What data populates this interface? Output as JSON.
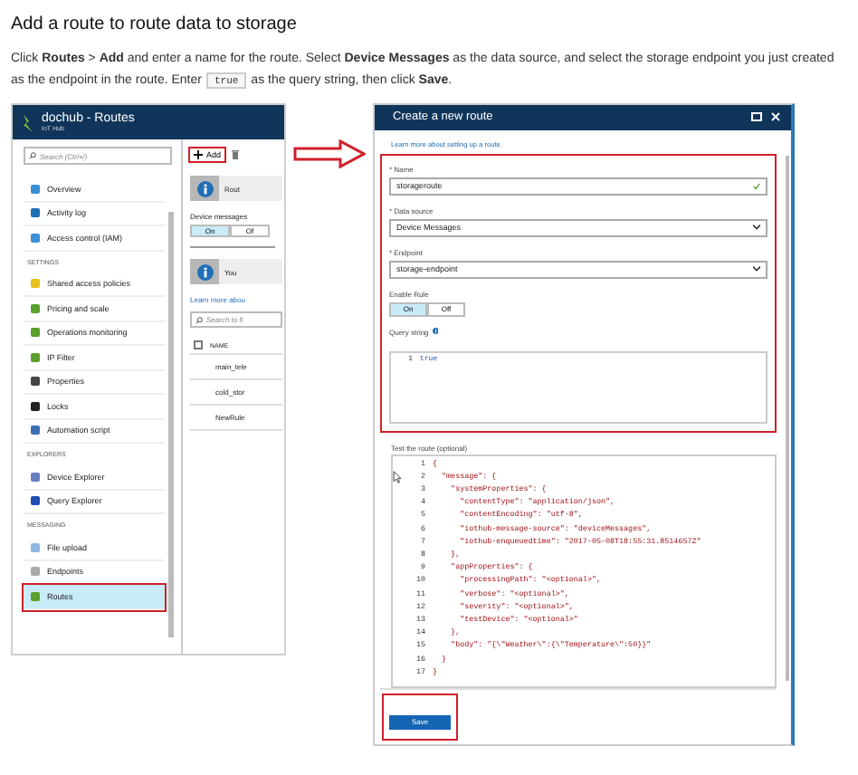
{
  "article": {
    "heading": "Add a route to route data to storage",
    "text_before": "Click **Routes** > **Add** and enter a name for the route. Select **Device Messages** as the data source, and select the storage endpoint you just created as the endpoint in the route. Enter",
    "code": "true",
    "text_after": "as the query string, then click **Save**."
  },
  "hub_blade": {
    "title": "dochub - Routes",
    "subtitle": "IoT Hub",
    "search": {
      "placeholder": "Search (Ctrl+/)"
    },
    "nav_groups": [
      {
        "items": [
          {
            "label": "Overview",
            "selected": false,
            "highlighted": false
          },
          {
            "label": "Activity log",
            "selected": false,
            "highlighted": false
          },
          {
            "label": "Access control (IAM)",
            "selected": false,
            "highlighted": false
          }
        ]
      },
      {
        "header": "SETTINGS",
        "items": [
          {
            "label": "Shared access policies",
            "selected": false,
            "highlighted": false
          },
          {
            "label": "Pricing and scale",
            "selected": false,
            "highlighted": false
          },
          {
            "label": "Operations monitoring",
            "selected": false,
            "highlighted": false
          },
          {
            "label": "IP Filter",
            "selected": false,
            "highlighted": false
          },
          {
            "label": "Properties",
            "selected": false,
            "highlighted": false
          },
          {
            "label": "Locks",
            "selected": false,
            "highlighted": false
          },
          {
            "label": "Automation script",
            "selected": false,
            "highlighted": false
          }
        ]
      },
      {
        "header": "EXPLORERS",
        "items": [
          {
            "label": "Device Explorer",
            "selected": false,
            "highlighted": false
          },
          {
            "label": "Query Explorer",
            "selected": false,
            "highlighted": false
          }
        ]
      },
      {
        "header": "MESSAGING",
        "items": [
          {
            "label": "File upload",
            "selected": false,
            "highlighted": false
          },
          {
            "label": "Endpoints",
            "selected": false,
            "highlighted": false
          },
          {
            "label": "Routes",
            "selected": true,
            "highlighted": true
          }
        ]
      }
    ],
    "routes_panel": {
      "add_button": {
        "label": "Add",
        "highlighted": true
      },
      "banners": [
        "Rout",
        "You"
      ],
      "device_messages": {
        "label": "Device messages",
        "options": [
          {
            "label": "On",
            "selected": true
          },
          {
            "label": "Of",
            "selected": false
          }
        ]
      },
      "learn_more": "Learn more abou",
      "search": {
        "placeholder": "Search to fi"
      },
      "table": {
        "column": "NAME",
        "checked": false,
        "rows": [
          "main_tele",
          "cold_stor",
          "NewRule"
        ]
      }
    }
  },
  "create_route": {
    "title": "Create a new route",
    "learn_more": "Learn more about setting up a route.",
    "highlighted": true,
    "fields": [
      {
        "kind": "text",
        "label": "* Name",
        "value": "storageroute",
        "valid": true
      },
      {
        "kind": "select",
        "label": "* Data source",
        "value": "Device Messages"
      },
      {
        "kind": "select",
        "label": "* Endpoint",
        "value": "storage-endpoint"
      }
    ],
    "enable_rule": {
      "label": "Enable Rule",
      "options": [
        {
          "label": "On",
          "selected": true
        },
        {
          "label": "Off",
          "selected": false
        }
      ]
    },
    "query_string": {
      "label": "Query string",
      "lines": [
        {
          "number": "1",
          "text": "true"
        }
      ]
    },
    "test": {
      "label": "Test the route (optional)",
      "lines": [
        {
          "number": "1",
          "text": "{"
        },
        {
          "number": "2",
          "text": "  \"message\": {"
        },
        {
          "number": "3",
          "text": "    \"systemProperties\": {"
        },
        {
          "number": "4",
          "text": "      \"contentType\": \"application/json\","
        },
        {
          "number": "5",
          "text": "      \"contentEncoding\": \"utf-8\","
        },
        {
          "number": "6",
          "text": "      \"iothub-message-source\": \"deviceMessages\","
        },
        {
          "number": "7",
          "text": "      \"iothub-enqueuedtime\": \"2017-05-08T18:55:31.8514657Z\""
        },
        {
          "number": "8",
          "text": "    },"
        },
        {
          "number": "9",
          "text": "    \"appProperties\": {"
        },
        {
          "number": "10",
          "text": "      \"processingPath\": \"<optional>\","
        },
        {
          "number": "11",
          "text": "      \"verbose\": \"<optional>\","
        },
        {
          "number": "12",
          "text": "      \"severity\": \"<optional>\","
        },
        {
          "number": "13",
          "text": "      \"testDevice\": \"<optional>\""
        },
        {
          "number": "14",
          "text": "    },"
        },
        {
          "number": "15",
          "text": "    \"body\": \"{\\\"Weather\\\":{\\\"Temperature\\\":50}}\""
        },
        {
          "number": "16",
          "text": "  }"
        },
        {
          "number": "17",
          "text": "}"
        }
      ]
    },
    "save": {
      "label": "Save",
      "highlighted": true
    }
  }
}
